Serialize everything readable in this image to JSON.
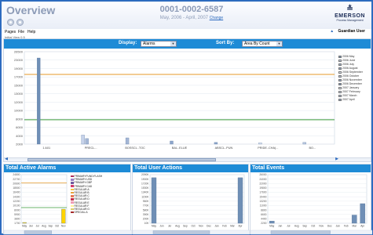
{
  "header": {
    "title": "Overview",
    "account": "0001-0002-6587",
    "date_range": "May, 2006 - April, 2007",
    "change_link": "Change",
    "logo_name": "EMERSON",
    "logo_sub": "Process Management"
  },
  "menu": {
    "items": [
      "Pages",
      "File",
      "Help"
    ],
    "user": "Guardian User"
  },
  "breadcrumb": "Initial View 0.5",
  "controls": {
    "display_label": "Display:",
    "display_value": "Alarms",
    "sortby_label": "Sort By:",
    "sortby_value": "Area By Count"
  },
  "colors": {
    "bar_header": "#1e8bd6",
    "accent": "#2d6bbf",
    "bar_primary": "#6f8fb6",
    "yellow": "#ffd400",
    "green": "#3a9a3a",
    "orange": "#e49a2a"
  },
  "chart_data": [
    {
      "type": "bar",
      "title": "",
      "categories": [
        "1 A01",
        "PRECL...",
        "BOSSCL..TOC",
        "BAL..ELUE",
        "ABSCL..PUN",
        "PRIDE..CHA(...",
        "BO..."
      ],
      "ytick_labels": [
        "26500",
        "23000",
        "19000",
        "17000",
        "15000",
        "13000",
        "12000",
        "10000",
        "8000",
        "6000",
        "4000",
        "2000"
      ],
      "series": [
        {
          "name": "2006 May",
          "values": [
            24700,
            0,
            0,
            0,
            0,
            0,
            0
          ]
        },
        {
          "name": "2006 June",
          "values": [
            0,
            2600,
            0,
            0,
            0,
            0,
            0
          ]
        },
        {
          "name": "2006 July",
          "values": [
            0,
            1600,
            1800,
            0,
            0,
            0,
            0
          ]
        },
        {
          "name": "2006 August",
          "values": [
            0,
            0,
            0,
            900,
            500,
            0,
            0
          ]
        },
        {
          "name": "2006 September",
          "values": [
            0,
            0,
            0,
            0,
            0,
            400,
            0
          ]
        },
        {
          "name": "2006 October",
          "values": [
            0,
            0,
            0,
            0,
            0,
            0,
            500
          ]
        },
        {
          "name": "2006 November",
          "values": [
            0,
            0,
            0,
            0,
            0,
            0,
            0
          ]
        },
        {
          "name": "2006 December",
          "values": [
            0,
            0,
            0,
            0,
            0,
            0,
            0
          ]
        },
        {
          "name": "2007 January",
          "values": [
            0,
            0,
            0,
            0,
            0,
            0,
            0
          ]
        },
        {
          "name": "2007 February",
          "values": [
            0,
            0,
            0,
            0,
            0,
            0,
            0
          ]
        },
        {
          "name": "2007 March",
          "values": [
            0,
            0,
            0,
            0,
            0,
            0,
            0
          ]
        },
        {
          "name": "2007 April",
          "values": [
            0,
            0,
            0,
            0,
            0,
            0,
            0
          ]
        }
      ],
      "threshold_lines": [
        20000,
        7000
      ],
      "grid": true,
      "legend_position": "right"
    },
    {
      "type": "bar",
      "title": "Total Active Alarms",
      "categories": [
        "May",
        "Jun",
        "Jul",
        "Aug",
        "Sep",
        "Oct",
        "Nov"
      ],
      "ytick_labels": [
        "24800",
        "22700",
        "20600",
        "18500",
        "16400",
        "14300",
        "12200",
        "10100",
        "8000",
        "5900",
        "3800",
        "1700"
      ],
      "values": [
        400,
        0,
        0,
        0,
        0,
        0,
        7200
      ],
      "legend": [
        "PRIMARYFUND:FLASH",
        "PRIMARY:USD",
        "PRIMARY:GBP",
        "PRIMARY:CAD",
        "REGULAR:A",
        "REGULAR:B",
        "REGULAR:C",
        "REGULAR:D",
        "REGULAR:E",
        "REGULAR:F",
        "REGULAR:G",
        "SPECIAL:A"
      ],
      "grid": true
    },
    {
      "type": "bar",
      "title": "Total User Actions",
      "categories": [
        "May",
        "Jun",
        "Jul",
        "Aug",
        "Sep",
        "Oct",
        "Nov",
        "Dec",
        "Jan",
        "Feb",
        "Mar",
        "Apr"
      ],
      "ytick_labels": [
        "2090K",
        "1900K",
        "1720K",
        "1530K",
        "1340K",
        "1150K",
        "960K",
        "770K",
        "580K",
        "390K",
        "200K",
        "10K"
      ],
      "values": [
        1960000,
        0,
        0,
        0,
        0,
        0,
        0,
        0,
        0,
        0,
        0,
        1960000
      ],
      "grid": true
    },
    {
      "type": "bar",
      "title": "Total Events",
      "categories": [
        "May",
        "Jun",
        "Jul",
        "Aug",
        "Sep",
        "Oct",
        "Nov",
        "Dec",
        "Jan",
        "Feb",
        "Mar",
        "Apr"
      ],
      "ytick_labels": [
        "26000",
        "24000",
        "22000",
        "19800",
        "17600",
        "15400",
        "13200",
        "11000",
        "8800",
        "6600",
        "4400",
        "2200"
      ],
      "values": [
        1200,
        0,
        0,
        0,
        0,
        0,
        0,
        0,
        0,
        0,
        4400,
        10500
      ],
      "grid": true
    }
  ]
}
